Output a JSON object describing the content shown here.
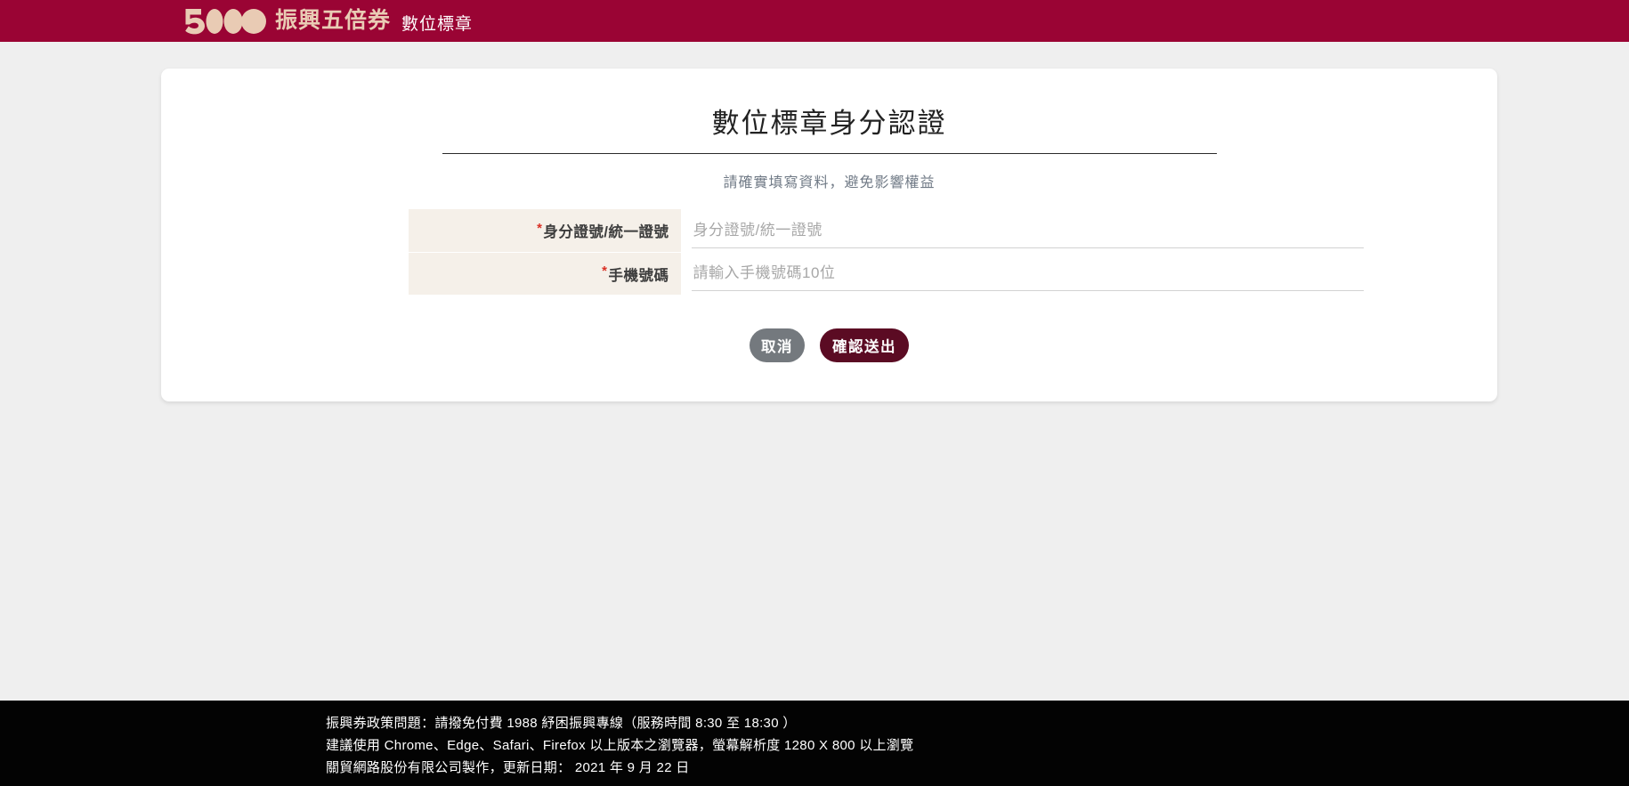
{
  "header": {
    "logo_icon": "five-thousand-voucher-logo",
    "logo_wordmark": "振興五倍券",
    "subtitle": "數位標章",
    "bg_color": "#9a0434",
    "wordmark_color": "#e9cbb4"
  },
  "card": {
    "title": "數位標章身分認證",
    "subtitle": "請確實填寫資料，避免影響權益",
    "form": {
      "rows": [
        {
          "required_mark": "*",
          "label": "身分證號/統一證號",
          "placeholder": "身分證號/統一證號",
          "value": ""
        },
        {
          "required_mark": "*",
          "label": "手機號碼",
          "placeholder": "請輸入手機號碼10位",
          "value": ""
        }
      ]
    },
    "buttons": {
      "cancel_label": "取消",
      "cancel_color": "#74797e",
      "submit_label": "確認送出",
      "submit_color": "#5b0b23"
    }
  },
  "footer": {
    "line1": "振興券政策問題：請撥免付費 1988 紓困振興專線（服務時間 8:30 至 18:30 ）",
    "line2": "建議使用 Chrome、Edge、Safari、Firefox 以上版本之瀏覽器，螢幕解析度 1280 X 800 以上瀏覽",
    "line3": "關貿網路股份有限公司製作，更新日期： 2021 年 9 月 22 日",
    "bg_color": "#030303"
  }
}
